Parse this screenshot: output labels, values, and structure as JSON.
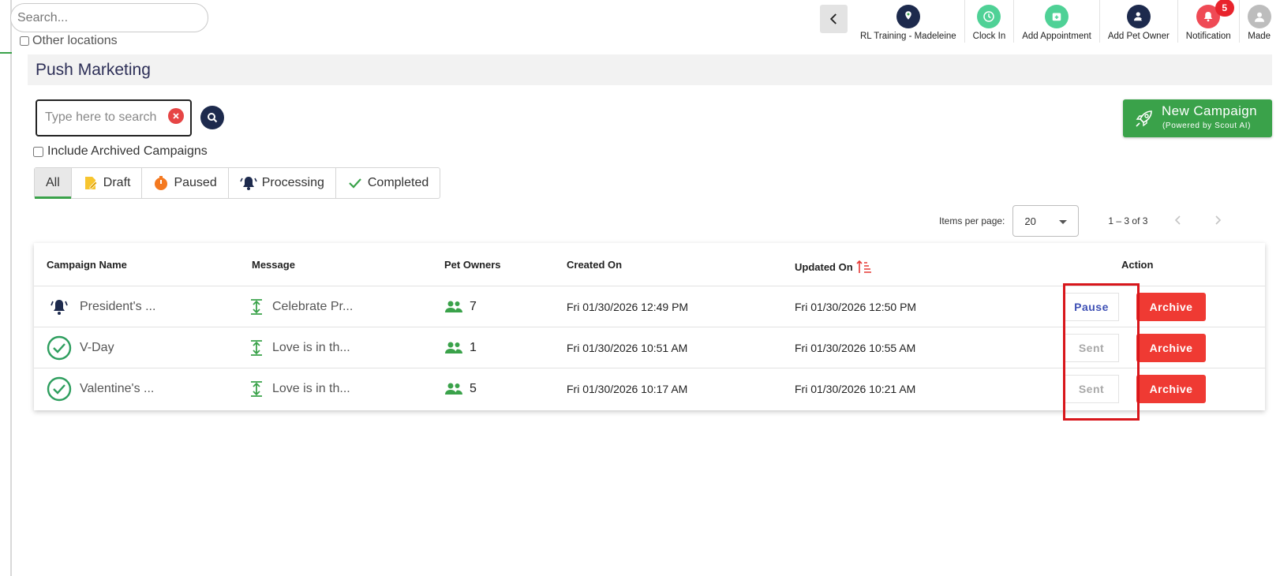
{
  "topbar": {
    "search_placeholder": "Search...",
    "other_locations_label": "Other locations",
    "tools": [
      {
        "label": "RL Training - Madeleine",
        "icon": "location-pin-icon",
        "color": "#1d2a4d"
      },
      {
        "label": "Clock In",
        "icon": "clock-icon",
        "color": "#4fd196"
      },
      {
        "label": "Add Appointment",
        "icon": "calendar-add-icon",
        "color": "#4fd196"
      },
      {
        "label": "Add Pet Owner",
        "icon": "user-add-icon",
        "color": "#1d2a4d"
      },
      {
        "label": "Notification",
        "icon": "bell-icon",
        "color": "#ef4a55",
        "badge": "5"
      },
      {
        "label": "Made",
        "icon": "avatar-icon",
        "color": "#bdbdbd"
      }
    ]
  },
  "page": {
    "title": "Push Marketing",
    "search_placeholder": "Type here to search",
    "include_archived_label": "Include Archived Campaigns",
    "new_campaign": {
      "title": "New Campaign",
      "subtitle": "(Powered by Scout AI)"
    },
    "tabs": [
      {
        "label": "All",
        "icon": ""
      },
      {
        "label": "Draft",
        "icon": "draft-icon"
      },
      {
        "label": "Paused",
        "icon": "timer-icon"
      },
      {
        "label": "Processing",
        "icon": "bell-icon"
      },
      {
        "label": "Completed",
        "icon": "check-icon"
      }
    ]
  },
  "pagination": {
    "items_per_page_label": "Items per page:",
    "items_per_page": "20",
    "range": "1 – 3 of 3"
  },
  "table": {
    "headers": {
      "name": "Campaign Name",
      "message": "Message",
      "owners": "Pet Owners",
      "created": "Created On",
      "updated": "Updated On",
      "action": "Action"
    },
    "rows": [
      {
        "status_icon": "bell-icon",
        "name": "President's ...",
        "message": "Celebrate Pr...",
        "owners": "7",
        "created": "Fri 01/30/2026 12:49 PM",
        "updated": "Fri 01/30/2026 12:50 PM",
        "action": "Pause",
        "archive": "Archive"
      },
      {
        "status_icon": "check-circle-icon",
        "name": "V-Day",
        "message": "Love is in th...",
        "owners": "1",
        "created": "Fri 01/30/2026 10:51 AM",
        "updated": "Fri 01/30/2026 10:55 AM",
        "action": "Sent",
        "archive": "Archive"
      },
      {
        "status_icon": "check-circle-icon",
        "name": "Valentine's ...",
        "message": "Love is in th...",
        "owners": "5",
        "created": "Fri 01/30/2026 10:17 AM",
        "updated": "Fri 01/30/2026 10:21 AM",
        "action": "Sent",
        "archive": "Archive"
      }
    ]
  },
  "colors": {
    "brand_green": "#3aa24a",
    "navy": "#1d2a4d",
    "archive_red": "#ef3a33",
    "highlight_red": "#d8161b"
  }
}
